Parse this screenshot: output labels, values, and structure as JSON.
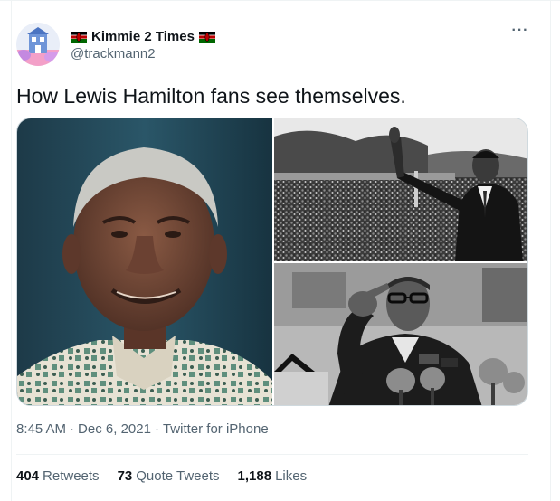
{
  "user": {
    "display_name": "Kimmie 2 Times",
    "handle": "@trackmann2",
    "flag_icon": "kenya-flag-icon",
    "avatar_colors": [
      "#8fb3e8",
      "#f3a0c8",
      "#ffffff"
    ]
  },
  "tweet": {
    "text": "How Lewis Hamilton fans see themselves.",
    "time": "8:45 AM",
    "date": "Dec 6, 2021",
    "source": "Twitter for iPhone",
    "sep": "·"
  },
  "more_icon": "···",
  "stats": {
    "retweets_count": "404",
    "retweets_label": "Retweets",
    "quotes_count": "73",
    "quotes_label": "Quote Tweets",
    "likes_count": "1,188",
    "likes_label": "Likes"
  },
  "colors": {
    "text_primary": "#0f1419",
    "text_secondary": "#536471",
    "border": "#cfd9de"
  }
}
